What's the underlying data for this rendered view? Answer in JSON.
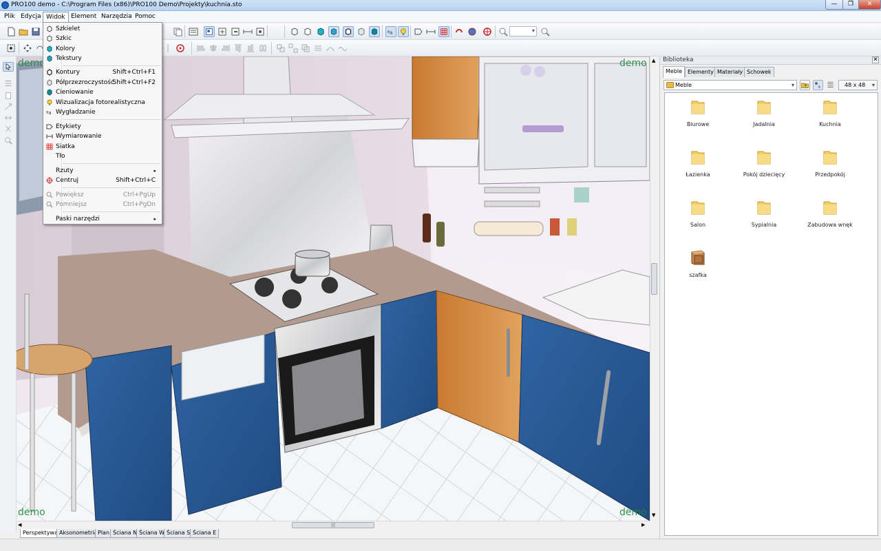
{
  "window": {
    "title": "PRO100 demo - C:\\Program Files (x86)\\PRO100 Demo\\Projekty\\kuchnia.sto",
    "min_glyph": "—",
    "max_glyph": "❐",
    "close_glyph": "✕"
  },
  "menubar": {
    "items": [
      "Plik",
      "Edycja",
      "Widok",
      "Element",
      "Narzędzia",
      "Pomoc"
    ],
    "active": "Widok"
  },
  "toolbar": {
    "zoom_value": ""
  },
  "viewport": {
    "watermark": "demo"
  },
  "widok_menu": {
    "items": [
      {
        "label": "Szkielet",
        "shortcut": "",
        "icon": "wireframe-icon"
      },
      {
        "label": "Szkic",
        "shortcut": "",
        "icon": "sketch-icon"
      },
      {
        "label": "Kolory",
        "shortcut": "",
        "icon": "colors-icon"
      },
      {
        "label": "Tekstury",
        "shortcut": "",
        "icon": "textures-icon"
      },
      {
        "label": "Kontury",
        "shortcut": "Shift+Ctrl+F1",
        "icon": "contours-icon"
      },
      {
        "label": "Półprzezroczystość",
        "shortcut": "Shift+Ctrl+F2",
        "icon": "transparency-icon"
      },
      {
        "label": "Cieniowanie",
        "shortcut": "",
        "icon": "shading-icon"
      },
      {
        "label": "Wizualizacja fotorealistyczna",
        "shortcut": "",
        "icon": "lightbulb-icon"
      },
      {
        "label": "Wygładzanie",
        "shortcut": "",
        "icon": "antialias-icon"
      },
      {
        "label": "Etykiety",
        "shortcut": "",
        "icon": "labels-icon"
      },
      {
        "label": "Wymiarowanie",
        "shortcut": "",
        "icon": "dimension-icon"
      },
      {
        "label": "Siatka",
        "shortcut": "",
        "icon": "grid-icon"
      },
      {
        "label": "Tło",
        "shortcut": "",
        "icon": ""
      },
      {
        "label": "Rzuty",
        "shortcut": "",
        "icon": ""
      },
      {
        "label": "Centruj",
        "shortcut": "Shift+Ctrl+C",
        "icon": "center-icon"
      },
      {
        "label": "Powiększ",
        "shortcut": "Ctrl+PgUp",
        "icon": "zoom-in-icon"
      },
      {
        "label": "Pomniejsz",
        "shortcut": "Ctrl+PgDn",
        "icon": "zoom-out-icon"
      },
      {
        "label": "Paski narzędzi",
        "shortcut": "",
        "icon": ""
      }
    ]
  },
  "view_tabs": [
    "Perspektywa",
    "Aksonometria",
    "Plan",
    "Ściana N",
    "Ściana W",
    "Ściana S",
    "Ściana E"
  ],
  "library": {
    "title": "Biblioteka",
    "close_glyph": "✕",
    "tabs": [
      "Meble",
      "Elementy",
      "Materiały",
      "Schowek"
    ],
    "path": "Meble",
    "icon_size": "48 x 48",
    "items": [
      {
        "label": "Biurowe",
        "type": "folder"
      },
      {
        "label": "Jadalnia",
        "type": "folder"
      },
      {
        "label": "Kuchnia",
        "type": "folder"
      },
      {
        "label": "Łazienka",
        "type": "folder"
      },
      {
        "label": "Pokój dziecięcy",
        "type": "folder"
      },
      {
        "label": "Przedpokój",
        "type": "folder"
      },
      {
        "label": "Salon",
        "type": "folder"
      },
      {
        "label": "Sypialnia",
        "type": "folder"
      },
      {
        "label": "Zabudowa wnęk",
        "type": "folder"
      },
      {
        "label": "szafka",
        "type": "cabinet"
      }
    ]
  }
}
